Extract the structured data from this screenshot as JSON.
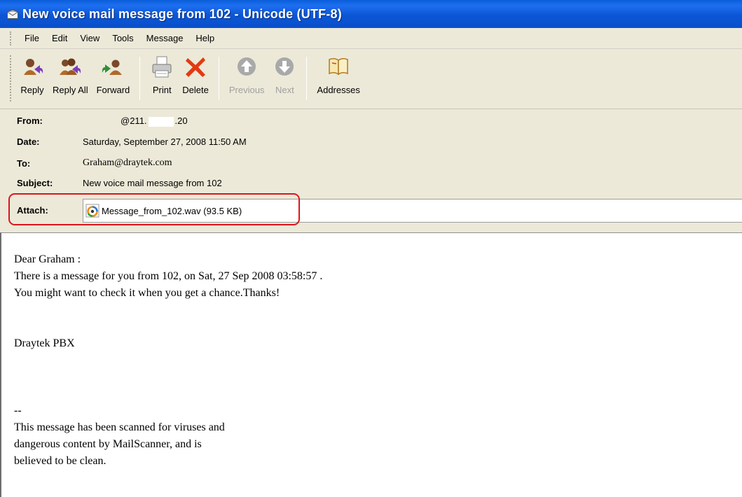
{
  "window": {
    "title": "New voice mail message from 102 - Unicode (UTF-8)"
  },
  "menu": {
    "items": [
      "File",
      "Edit",
      "View",
      "Tools",
      "Message",
      "Help"
    ]
  },
  "toolbar": {
    "buttons": [
      {
        "label": "Reply",
        "icon": "reply-icon",
        "enabled": true
      },
      {
        "label": "Reply All",
        "icon": "reply-all-icon",
        "enabled": true
      },
      {
        "label": "Forward",
        "icon": "forward-icon",
        "enabled": true
      },
      {
        "label": "Print",
        "icon": "printer-icon",
        "enabled": true
      },
      {
        "label": "Delete",
        "icon": "delete-icon",
        "enabled": true
      },
      {
        "label": "Previous",
        "icon": "up-arrow-icon",
        "enabled": false
      },
      {
        "label": "Next",
        "icon": "down-arrow-icon",
        "enabled": false
      },
      {
        "label": "Addresses",
        "icon": "address-book-icon",
        "enabled": true
      }
    ]
  },
  "header": {
    "from_label": "From:",
    "from_prefix": "@211.",
    "from_suffix": ".20",
    "date_label": "Date:",
    "date_value": "Saturday, September 27, 2008 11:50 AM",
    "to_label": "To:",
    "to_value": "Graham@draytek.com",
    "subject_label": "Subject:",
    "subject_value": "New voice mail message from 102",
    "attach_label": "Attach:",
    "attach_file": "Message_from_102.wav (93.5 KB)"
  },
  "body": {
    "lines": [
      "Dear Graham :",
      "There is a message for you from 102, on Sat, 27 Sep 2008 03:58:57 .",
      "You might want to check it when you get a chance.Thanks!",
      "",
      "",
      "Draytek PBX",
      "",
      "",
      "",
      "--",
      "This message has been scanned for viruses and",
      "dangerous content by MailScanner, and is",
      "believed to be clean."
    ]
  },
  "colors": {
    "titlebar": "#0b56d6",
    "chrome": "#ece9d8",
    "highlight": "#e0141c",
    "disabled_text": "#a0a0a0"
  }
}
